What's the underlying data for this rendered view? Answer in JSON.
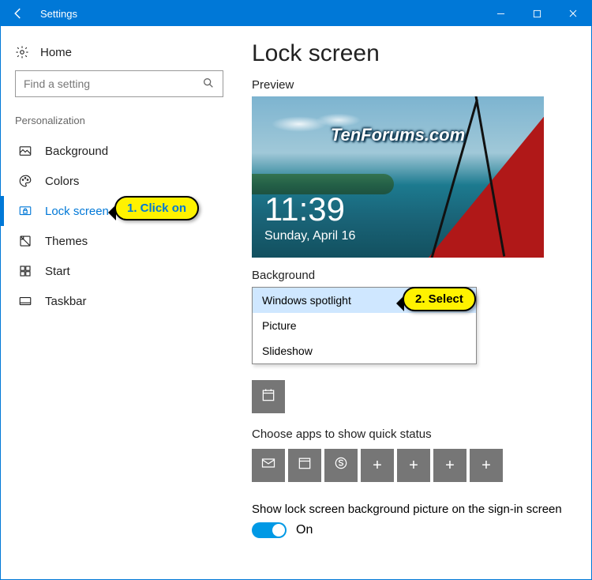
{
  "window": {
    "title": "Settings"
  },
  "sidebar": {
    "home": "Home",
    "search_placeholder": "Find a setting",
    "section": "Personalization",
    "items": [
      {
        "label": "Background"
      },
      {
        "label": "Colors"
      },
      {
        "label": "Lock screen"
      },
      {
        "label": "Themes"
      },
      {
        "label": "Start"
      },
      {
        "label": "Taskbar"
      }
    ]
  },
  "page": {
    "title": "Lock screen",
    "preview_label": "Preview",
    "preview": {
      "watermark": "TenForums.com",
      "time": "11:39",
      "date": "Sunday, April 16"
    },
    "bg_label": "Background",
    "bg_options": [
      "Windows spotlight",
      "Picture",
      "Slideshow"
    ],
    "quick_label": "Choose apps to show quick status",
    "signin_label": "Show lock screen background picture on the sign-in screen",
    "toggle_state": "On"
  },
  "annotations": {
    "step1": "1. Click on",
    "step2": "2. Select"
  }
}
